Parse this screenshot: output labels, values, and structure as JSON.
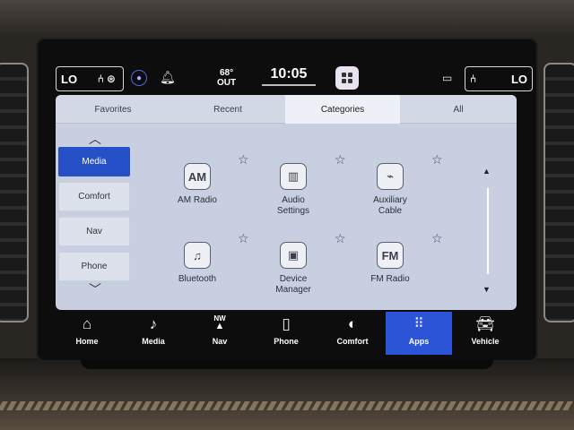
{
  "status": {
    "left_seat": {
      "label": "LO"
    },
    "right_seat": {
      "label": "LO"
    },
    "temperature": "68°",
    "temperature_unit": "OUT",
    "time": "10:05"
  },
  "tabs": [
    {
      "label": "Favorites"
    },
    {
      "label": "Recent"
    },
    {
      "label": "Categories"
    },
    {
      "label": "All"
    }
  ],
  "categories": [
    {
      "label": "Media"
    },
    {
      "label": "Comfort"
    },
    {
      "label": "Nav"
    },
    {
      "label": "Phone"
    }
  ],
  "apps": [
    {
      "label": "AM Radio",
      "glyph": "AM",
      "icon": "am-radio-icon"
    },
    {
      "label": "Audio Settings",
      "glyph": "▥",
      "icon": "audio-settings-icon"
    },
    {
      "label": "Auxiliary Cable",
      "glyph": "⌁",
      "icon": "aux-cable-icon"
    },
    {
      "label": "Bluetooth",
      "glyph": "♫",
      "icon": "bluetooth-icon"
    },
    {
      "label": "Device Manager",
      "glyph": "▣",
      "icon": "device-manager-icon"
    },
    {
      "label": "FM Radio",
      "glyph": "FM",
      "icon": "fm-radio-icon"
    }
  ],
  "nav": [
    {
      "label": "Home",
      "icon": "home-icon"
    },
    {
      "label": "Media",
      "icon": "music-note-icon"
    },
    {
      "label": "Nav",
      "icon": "compass-icon",
      "compass": "NW"
    },
    {
      "label": "Phone",
      "icon": "phone-icon"
    },
    {
      "label": "Comfort",
      "icon": "comfort-icon"
    },
    {
      "label": "Apps",
      "icon": "apps-grid-icon"
    },
    {
      "label": "Vehicle",
      "icon": "vehicle-icon"
    }
  ],
  "colors": {
    "accent": "#2b55d6",
    "panel": "#c8cfe0"
  }
}
